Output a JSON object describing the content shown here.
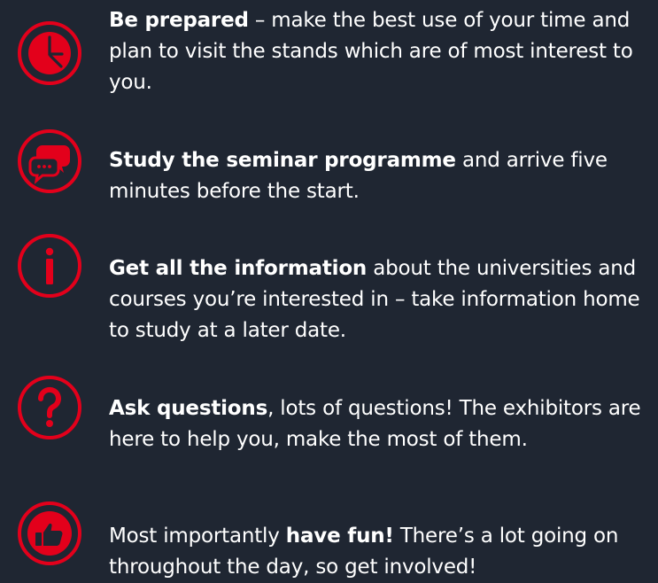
{
  "theme": {
    "background": "#1f2632",
    "accent": "#e3001b",
    "text": "#ffffff"
  },
  "tips": [
    {
      "icon": "clock-icon",
      "bold": "Be prepared",
      "after": " – make the best use of your time and plan to visit the stands which are of most interest to you."
    },
    {
      "icon": "speech-bubbles-icon",
      "bold": "Study the seminar programme",
      "after": " and arrive five minutes before the start."
    },
    {
      "icon": "info-icon",
      "bold": "Get all the information",
      "after": " about the universities and courses you’re interested in – take information home to study at a later date."
    },
    {
      "icon": "question-mark-icon",
      "bold": "Ask questions",
      "after": ", lots of questions! The exhibitors are here to help you, make the most of them."
    },
    {
      "icon": "thumbs-up-icon",
      "before": "Most importantly ",
      "bold": "have fun!",
      "after": " There’s a lot going on throughout the day, so get involved!"
    }
  ]
}
